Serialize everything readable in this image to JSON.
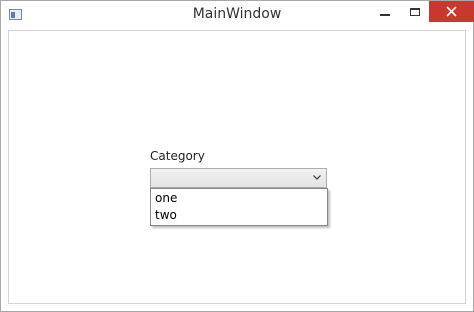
{
  "window": {
    "title": "MainWindow"
  },
  "form": {
    "category_label": "Category",
    "category_selected": "",
    "category_options": [
      "one",
      "two"
    ]
  },
  "icons": {
    "app": "app-window-icon",
    "minimize": "minimize-icon",
    "maximize": "maximize-icon",
    "close": "close-icon",
    "dropdown": "chevron-down-icon"
  },
  "colors": {
    "close_button": "#c7392e",
    "combo_border": "#acacac",
    "dropdown_border": "#828790"
  }
}
